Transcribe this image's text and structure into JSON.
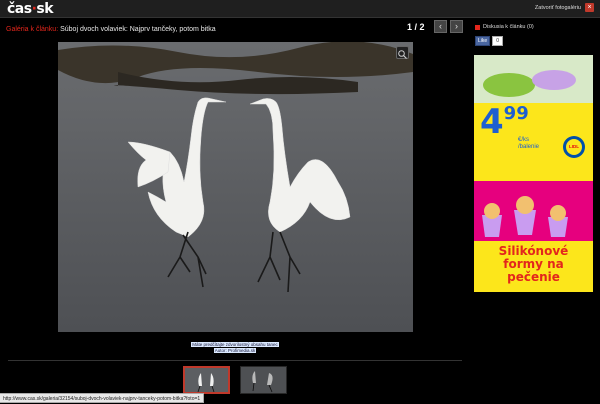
{
  "header": {
    "logo_text": "čas",
    "logo_dot": "·",
    "logo_suffix": "sk",
    "close_label": "Zatvoriť fotogalériu",
    "close_symbol": "×"
  },
  "gallery": {
    "link_label": "Galéria k článku:",
    "title": "Súboj dvoch volaviek: Najprv tančeky, potom bitka",
    "counter": "1 / 2",
    "prev_symbol": "‹",
    "next_symbol": "›"
  },
  "caption": {
    "line1": "Máte predčítajte zdvorilostný obsahu tanec",
    "line2": "Autor: Profimedia.sk"
  },
  "sidebar": {
    "discussion": "Diskusia k článku (0)",
    "fb_like": "Like",
    "fb_count": "0"
  },
  "ad": {
    "price_main": "4",
    "price_decimal": "99",
    "price_unit": "€/ks",
    "price_sub": "/balenie",
    "brand": "LIDL",
    "headline": "Silikónové formy na pečenie"
  },
  "status_bar": {
    "url": "http://www.cas.sk/galeria/32154/suboj-dvoch-volaviek-najprv-tanceky-potom-bitka?foto=1"
  },
  "colors": {
    "accent": "#e3261c",
    "background": "#000000",
    "ad_yellow": "#fce61b",
    "ad_blue": "#3f6fd1",
    "ad_pink": "#e6007e"
  }
}
